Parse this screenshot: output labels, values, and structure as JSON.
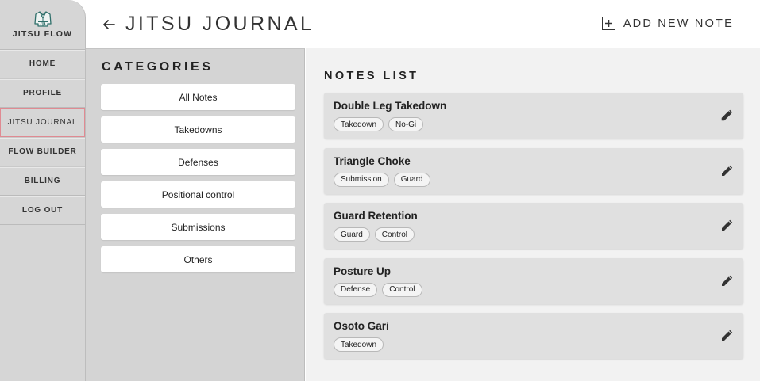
{
  "app": {
    "name": "JITSU FLOW"
  },
  "sidebar": {
    "items": [
      {
        "label": "HOME",
        "active": false
      },
      {
        "label": "PROFILE",
        "active": false
      },
      {
        "label": "JITSU JOURNAL",
        "active": true
      },
      {
        "label": "FLOW BUILDER",
        "active": false
      },
      {
        "label": "BILLING",
        "active": false
      },
      {
        "label": "LOG OUT",
        "active": false
      }
    ]
  },
  "header": {
    "title": "JITSU JOURNAL",
    "back_icon": "arrow-left-icon",
    "add_note_label": "ADD NEW NOTE",
    "add_note_icon": "plus-square-icon"
  },
  "categories": {
    "title": "CATEGORIES",
    "items": [
      "All Notes",
      "Takedowns",
      "Defenses",
      "Positional control",
      "Submissions",
      "Others"
    ]
  },
  "notes": {
    "title": "NOTES LIST",
    "edit_icon": "pencil-icon",
    "items": [
      {
        "title": "Double Leg Takedown",
        "tags": [
          "Takedown",
          "No-Gi"
        ]
      },
      {
        "title": "Triangle Choke",
        "tags": [
          "Submission",
          "Guard"
        ]
      },
      {
        "title": "Guard Retention",
        "tags": [
          "Guard",
          "Control"
        ]
      },
      {
        "title": "Posture Up",
        "tags": [
          "Defense",
          "Control"
        ]
      },
      {
        "title": "Osoto Gari",
        "tags": [
          "Takedown"
        ]
      }
    ]
  },
  "colors": {
    "sidebar_bg": "#d6d6d6",
    "categories_bg": "#d4d4d4",
    "notes_bg": "#f2f2f2",
    "card_bg": "#e0e0e0",
    "active_border": "#e08a92",
    "logo_accent": "#2f6f6a"
  }
}
